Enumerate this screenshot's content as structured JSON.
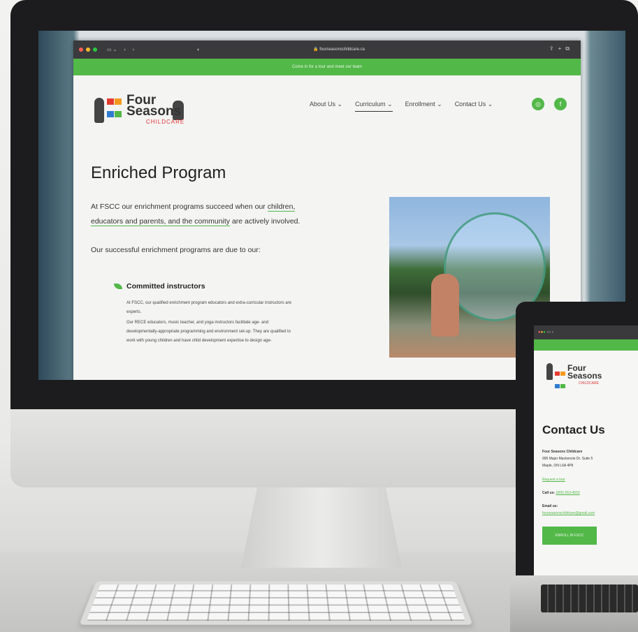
{
  "browser": {
    "url": "fourseasonschildcare.ca",
    "banner": "Come in for a tour and meet our team"
  },
  "logo": {
    "word1": "Four",
    "word2": "Seasons",
    "sub": "CHILDCARE"
  },
  "nav": {
    "items": [
      "About Us ⌄",
      "Curriculum ⌄",
      "Enrollment ⌄",
      "Contact Us ⌄"
    ],
    "active": "Curriculum ⌄"
  },
  "social": {
    "instagram": "◎",
    "facebook": "f"
  },
  "page": {
    "title": "Enriched Program",
    "intro_a": "At FSCC our enrichment programs succeed when our",
    "intro_link": "children, educators and parents, and the community",
    "intro_b": "are actively involved.",
    "lead": "Our successful enrichment programs are due to our:",
    "feature_title": "Committed instructors",
    "feature_p1": "At FSCC, our qualified enrichment program educators and extra-curricular instructors are experts.",
    "feature_p2": "Our RECE educators, music teacher, and yoga instructors facilitate age- and developmentally-appropriate programming and environment set-up. They are qualified to work with young children and have child development expertise to design age-"
  },
  "laptop": {
    "title": "Contact Us",
    "org": "Four Seasons Childcare",
    "address1": "995 Major Mackenzie Dr. Suite 5",
    "address2": "Maple, ON L6A 4P8",
    "tour_link": "Request a tour",
    "call_label": "Call us:",
    "call_value": "(905) 553-4553",
    "email_label": "Email us:",
    "email_value": "fourseasonschildcare@gmail.com",
    "button": "ENROLL IN FSCC"
  },
  "colors": {
    "accent": "#52b848",
    "logo_red": "#e53b2f",
    "logo_orange": "#f39a1e",
    "logo_blue": "#2f7bd0",
    "logo_green": "#52b848"
  }
}
